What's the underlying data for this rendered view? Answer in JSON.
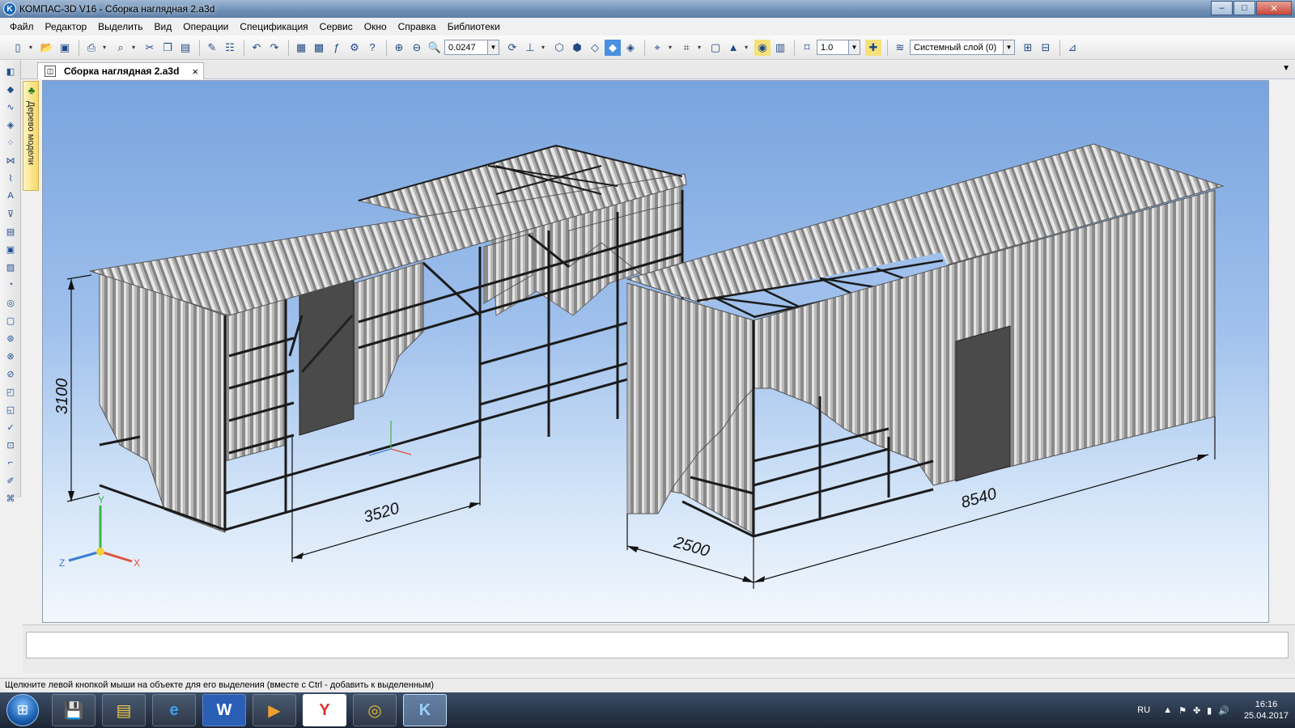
{
  "window": {
    "title": "КОМПАС-3D V16  - Сборка наглядная 2.a3d",
    "minimize": "‒",
    "maximize": "□",
    "close": "✕"
  },
  "menu": {
    "items": [
      "Файл",
      "Редактор",
      "Выделить",
      "Вид",
      "Операции",
      "Спецификация",
      "Сервис",
      "Окно",
      "Справка",
      "Библиотеки"
    ]
  },
  "toolbar": {
    "zoom_value": "0.0247",
    "step_value": "1.0",
    "layer_value": "Системный слой (0)"
  },
  "document_tab": {
    "label": "Сборка наглядная 2.a3d",
    "close": "×"
  },
  "model_tree": {
    "label": "Дерево модели"
  },
  "dimensions": {
    "height": "3100",
    "width_left": "3520",
    "depth": "2500",
    "length": "8540"
  },
  "axes": {
    "x": "X",
    "y": "Y",
    "z": "Z"
  },
  "status": {
    "hint": "Щелкните левой кнопкой мыши на объекте для его выделения (вместе с Ctrl - добавить к выделенным)"
  },
  "taskbar": {
    "apps": [
      {
        "name": "save",
        "glyph": "💾"
      },
      {
        "name": "explorer",
        "glyph": "▤"
      },
      {
        "name": "ie",
        "glyph": "e"
      },
      {
        "name": "word",
        "glyph": "W"
      },
      {
        "name": "media",
        "glyph": "▶"
      },
      {
        "name": "yandex",
        "glyph": "Y"
      },
      {
        "name": "chrome",
        "glyph": "◎"
      },
      {
        "name": "kompas",
        "glyph": "K"
      }
    ],
    "lang": "RU",
    "time": "16:16",
    "date": "25.04.2017"
  },
  "colors": {
    "sheet": "#a9a9a9",
    "frame": "#1b1b1b",
    "door": "#4a4a4a",
    "sky_top": "#78a4de"
  }
}
